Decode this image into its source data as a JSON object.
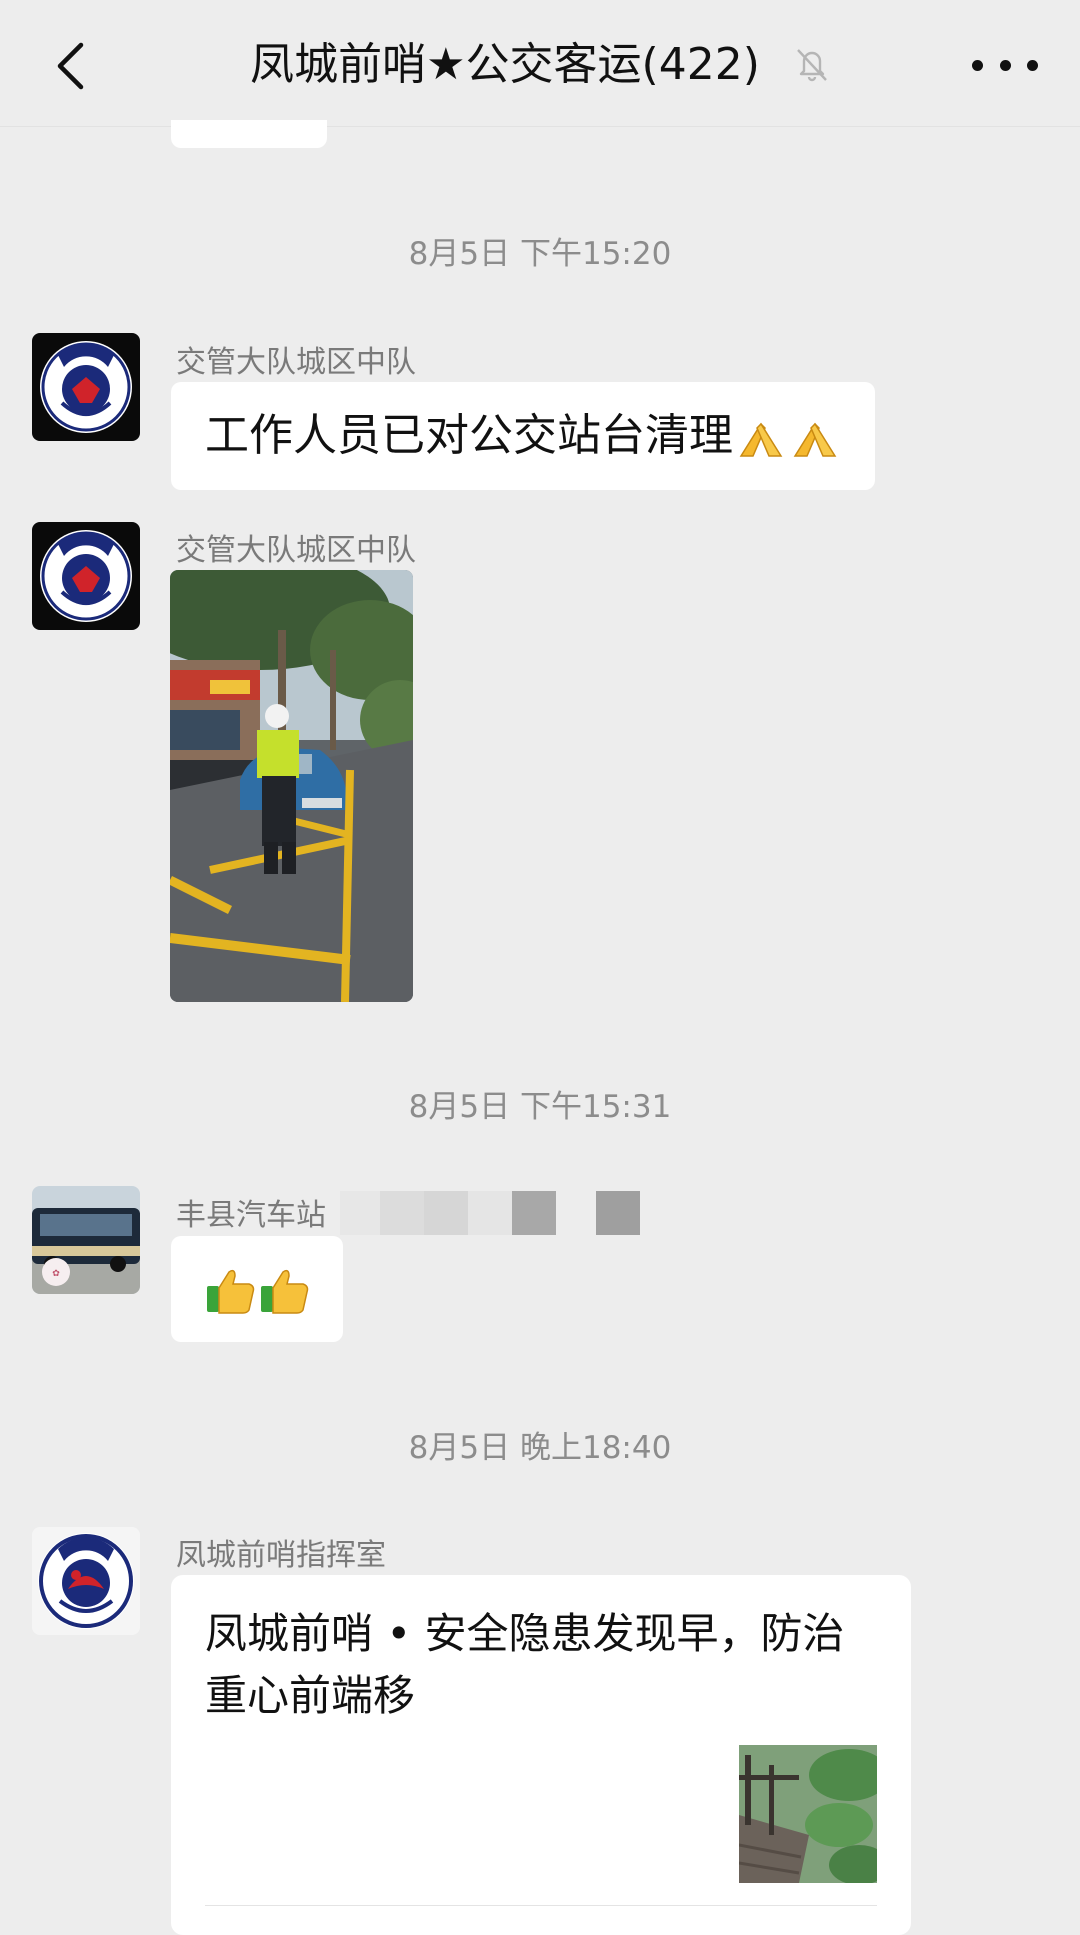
{
  "header": {
    "back_icon": "chevron-left-icon",
    "title": "凤城前哨★公交客运(422)",
    "mute_icon": "bell-muted-icon",
    "more_icon": "more-dots-icon"
  },
  "messages": {
    "t1": "8月5日 下午15:20",
    "m1_sender": "交管大队城区中队",
    "m1_text": "工作人员已对公交站台清理",
    "m2_sender": "交管大队城区中队",
    "t2": "8月5日 下午15:31",
    "m3_sender": "丰县汽车站",
    "t3": "8月5日 晚上18:40",
    "m4_sender": "凤城前哨指挥室",
    "m4_card_title": "凤城前哨 • 安全隐患发现早，防治重心前端移"
  },
  "colors": {
    "background": "#ededed",
    "bubble": "#ffffff",
    "meta_text": "#8c8c8c"
  }
}
